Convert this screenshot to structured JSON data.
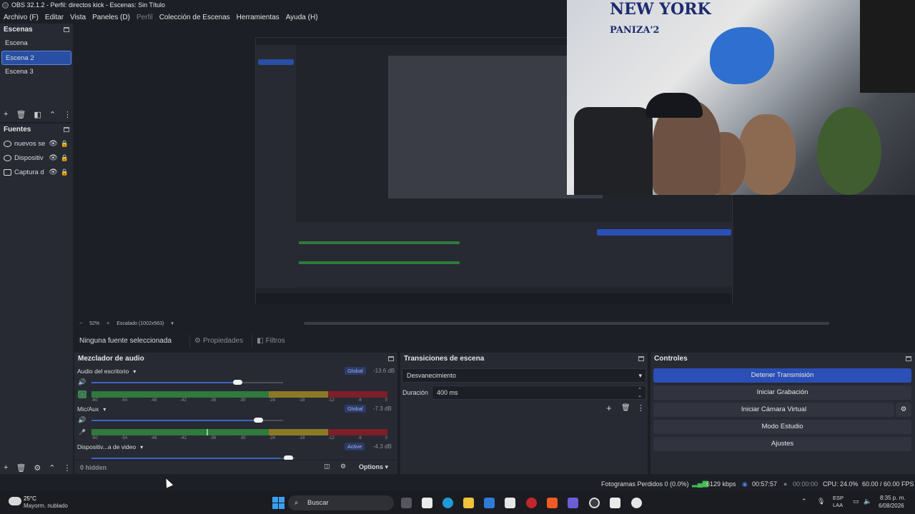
{
  "window": {
    "title": "OBS 32.1.2 - Perfil: directos kick - Escenas: Sin Título"
  },
  "menu": [
    {
      "label": "Archivo (F)",
      "enabled": true
    },
    {
      "label": "Editar",
      "enabled": true
    },
    {
      "label": "Vista",
      "enabled": true
    },
    {
      "label": "Paneles (D)",
      "enabled": true
    },
    {
      "label": "Perfil",
      "enabled": false
    },
    {
      "label": "Colección de Escenas",
      "enabled": true
    },
    {
      "label": "Herramientas",
      "enabled": true
    },
    {
      "label": "Ayuda (H)",
      "enabled": true
    }
  ],
  "scenes": {
    "title": "Escenas",
    "items": [
      "Escena",
      "Escena 2",
      "Escena 3"
    ],
    "selected": "Escena 2"
  },
  "sources": {
    "title": "Fuentes",
    "items": [
      "nuevos se",
      "Dispositiv",
      "Captura d"
    ],
    "hidden_label": "0 hidden"
  },
  "preview_bar": {
    "zoom": "52%",
    "scale": "Escalado (1002x563)"
  },
  "context": {
    "no_source": "Ninguna fuente seleccionada",
    "properties": "Propiedades",
    "filters": "Filtros"
  },
  "mixer": {
    "title": "Mezclador de audio",
    "channels": [
      {
        "name": "Audio del escritorio",
        "badge": "Global",
        "db": "-13.6 dB",
        "volume": 0.76,
        "level": 0.0
      },
      {
        "name": "Mic/Aux",
        "badge": "Global",
        "db": "-7.3 dB",
        "volume": 0.87,
        "level": 0.39
      },
      {
        "name": "Dispositiv...a de video",
        "badge": "Active",
        "db": "-4.3 dB",
        "volume": 0.98,
        "level": 0.0
      }
    ],
    "ticks": [
      "-60",
      "-54",
      "-48",
      "-42",
      "-36",
      "-30",
      "-24",
      "-18",
      "-12",
      "-6",
      "0"
    ],
    "options_label": "Options"
  },
  "transitions": {
    "title": "Transiciones de escena",
    "type": "Desvanecimiento",
    "duration_label": "Duración",
    "duration": "400 ms"
  },
  "controls": {
    "title": "Controles",
    "buttons": [
      "Detener Transmisión",
      "Iniciar Grabación",
      "Iniciar Cámara Virtual",
      "Modo Estudio",
      "Ajustes"
    ]
  },
  "status": {
    "dropped": "Fotogramas Perdidos 0 (0.0%)",
    "bitrate": "6129 kbps",
    "stream_time": "00:57:57",
    "rec_time": "00:00:00",
    "cpu": "CPU: 24.0%",
    "fps": "60.00 / 60.00 FPS"
  },
  "taskbar": {
    "weather_temp": "25°C",
    "weather_desc": "Mayorm. nublado",
    "search": "Buscar",
    "lang": "ESP",
    "lang2": "LAA",
    "time": "8:35 p. m.",
    "date": "6/08/2026"
  },
  "webcam": {
    "wall_text": "NEW YORK",
    "wall_sub": "PANIZA'2"
  },
  "colors": {
    "accent": "#2b4fb6",
    "selected": "#284fa3",
    "meter_green": "#2f7a3c",
    "meter_yellow": "#8a7a25",
    "meter_red": "#7c1f28"
  }
}
